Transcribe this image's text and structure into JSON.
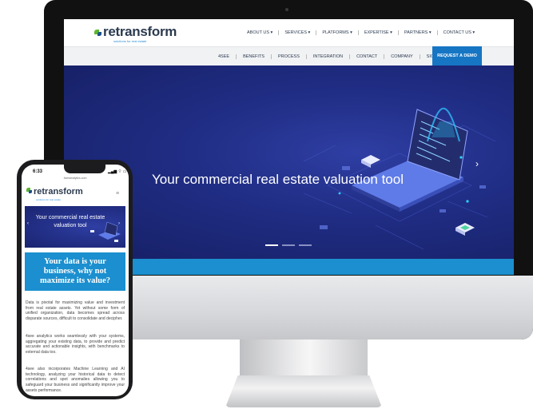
{
  "desktop": {
    "logo": {
      "word": "retransform",
      "tagline": "solutions for real estate"
    },
    "main_nav": [
      "ABOUT US ▾",
      "SERVICES ▾",
      "PLATFORMS ▾",
      "EXPERTISE ▾",
      "PARTNERS ▾",
      "CONTACT US ▾"
    ],
    "sub_nav": [
      "4SEE",
      "BENEFITS",
      "PROCESS",
      "INTEGRATION",
      "CONTACT",
      "COMPANY",
      "SIGN IN"
    ],
    "cta": "REQUEST A DEMO",
    "hero_title": "Your commercial real estate valuation tool",
    "next_arrow": "›",
    "slides": 3,
    "active_slide": 1
  },
  "phone": {
    "time": "6:33",
    "status": "▂▄▆ ⌔ ▭",
    "url": "4seeanalytics.com",
    "logo": {
      "word": "retransform",
      "tagline": "solutions for real estate"
    },
    "menu_icon": "≡",
    "hero_title": "Your commercial real estate valuation tool",
    "prev_arrow": "‹",
    "next_arrow": "›",
    "headline": "Your data is your business, why not maximize its value?",
    "paragraphs": [
      "Data is pivotal for maximizing value and investment from real estate assets. Yet without some form of unified organization, data becomes spread across disparate sources, difficult to consolidate and decipher.",
      "4see analytics works seamlessly with your systems, aggregating your existing data, to provide and predict accurate and actionable insights, with benchmarks to external data too.",
      "4see also incorporates Machine Learning and AI technology, analyzing your historical data to detect correlations and spot anomalies allowing you to safeguard your business and significantly improve your assets performance."
    ]
  },
  "device": {
    "apple_logo": ""
  },
  "colors": {
    "brand_blue": "#1676c4",
    "hero_navy": "#1f2c82",
    "strip_blue": "#1b8fcf",
    "leaf_green": "#5cb531"
  }
}
